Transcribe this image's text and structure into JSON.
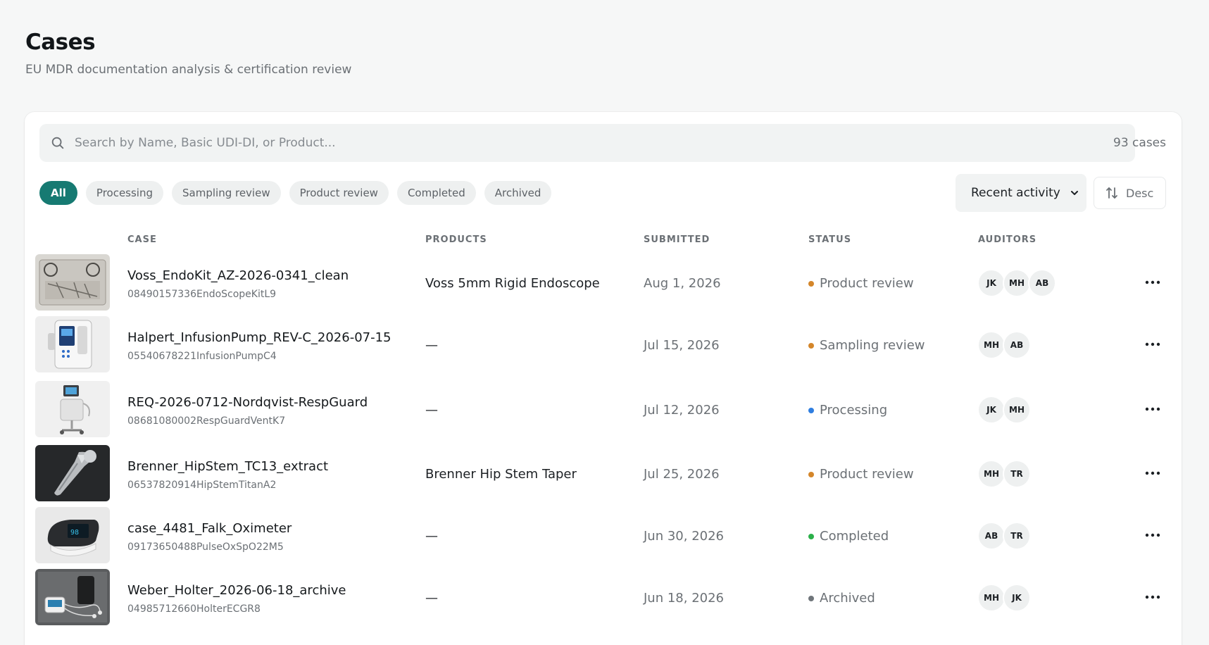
{
  "page": {
    "title": "Cases",
    "subtitle": "EU MDR documentation analysis & certification review"
  },
  "search": {
    "placeholder": "Search by Name, Basic UDI-DI, or Product...",
    "count_label": "93 cases"
  },
  "filters": [
    {
      "label": "All",
      "active": true
    },
    {
      "label": "Processing",
      "active": false
    },
    {
      "label": "Sampling review",
      "active": false
    },
    {
      "label": "Product review",
      "active": false
    },
    {
      "label": "Completed",
      "active": false
    },
    {
      "label": "Archived",
      "active": false
    }
  ],
  "sort": {
    "selected": "Recent activity",
    "direction_label": "Desc"
  },
  "columns": {
    "case": "CASE",
    "products": "PRODUCTS",
    "submitted": "SUBMITTED",
    "status": "STATUS",
    "auditors": "AUDITORS"
  },
  "status_colors": {
    "Product review": "#d4862a",
    "Sampling review": "#d4862a",
    "Processing": "#2f7ee0",
    "Completed": "#2bb04a",
    "Archived": "#6f757a"
  },
  "accent_color": "#167a72",
  "rows": [
    {
      "name": "Voss_EndoKit_AZ-2026-0341_clean",
      "udi": "08490157336EndoScopeKitL9",
      "product": "Voss 5mm Rigid Endoscope",
      "submitted": "Aug 1, 2026",
      "status": "Product review",
      "auditors": [
        "JK",
        "MH",
        "AB"
      ],
      "thumb": "endoscope-kit-image"
    },
    {
      "name": "Halpert_InfusionPump_REV-C_2026-07-15",
      "udi": "05540678221InfusionPumpC4",
      "product": "—",
      "submitted": "Jul 15, 2026",
      "status": "Sampling review",
      "auditors": [
        "MH",
        "AB"
      ],
      "thumb": "infusion-pump-image"
    },
    {
      "name": "REQ-2026-0712-Nordqvist-RespGuard",
      "udi": "08681080002RespGuardVentK7",
      "product": "—",
      "submitted": "Jul 12, 2026",
      "status": "Processing",
      "auditors": [
        "JK",
        "MH"
      ],
      "thumb": "ventilator-image"
    },
    {
      "name": "Brenner_HipStem_TC13_extract",
      "udi": "06537820914HipStemTitanA2",
      "product": "Brenner Hip Stem Taper",
      "submitted": "Jul 25, 2026",
      "status": "Product review",
      "auditors": [
        "MH",
        "TR"
      ],
      "thumb": "hip-stem-image"
    },
    {
      "name": "case_4481_Falk_Oximeter",
      "udi": "09173650488PulseOxSpO22M5",
      "product": "—",
      "submitted": "Jun 30, 2026",
      "status": "Completed",
      "auditors": [
        "AB",
        "TR"
      ],
      "thumb": "pulse-oximeter-image"
    },
    {
      "name": "Weber_Holter_2026-06-18_archive",
      "udi": "04985712660HolterECGR8",
      "product": "—",
      "submitted": "Jun 18, 2026",
      "status": "Archived",
      "auditors": [
        "MH",
        "JK"
      ],
      "thumb": "holter-monitor-image"
    }
  ]
}
